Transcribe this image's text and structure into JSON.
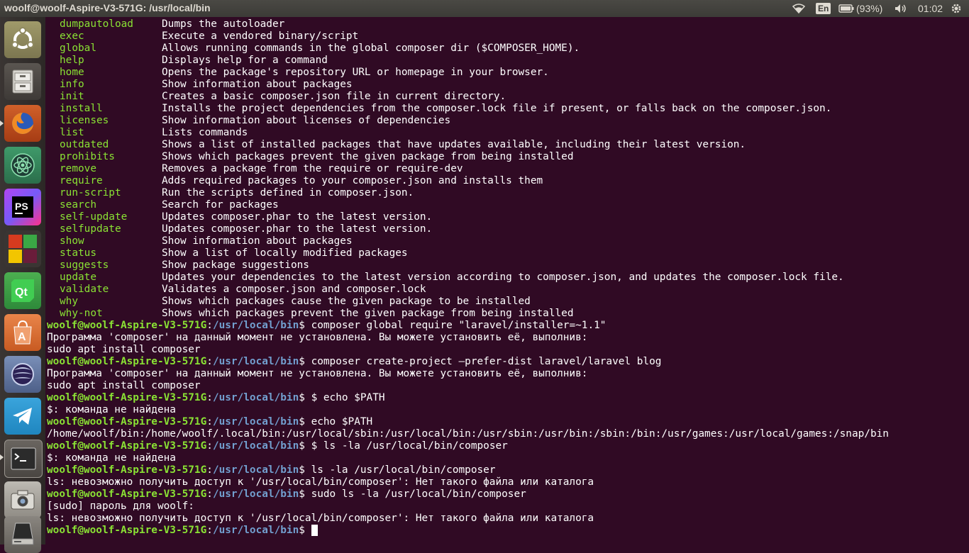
{
  "window": {
    "title": "woolf@woolf-Aspire-V3-571G: /usr/local/bin"
  },
  "panel": {
    "language": "En",
    "battery": "(93%)",
    "clock": "01:02"
  },
  "launcher": {
    "items": [
      "Ubuntu Dash",
      "Files",
      "Firefox",
      "Atom",
      "PhpStorm",
      "Workspace Switcher",
      "Qt Creator",
      "Ubuntu Software",
      "Eclipse",
      "Telegram",
      "Terminal",
      "Camera",
      "Removable Drive"
    ]
  },
  "terminal": {
    "commands": [
      {
        "cmd": "dumpautoload",
        "desc": "Dumps the autoloader"
      },
      {
        "cmd": "exec",
        "desc": "Execute a vendored binary/script"
      },
      {
        "cmd": "global",
        "desc": "Allows running commands in the global composer dir ($COMPOSER_HOME)."
      },
      {
        "cmd": "help",
        "desc": "Displays help for a command"
      },
      {
        "cmd": "home",
        "desc": "Opens the package's repository URL or homepage in your browser."
      },
      {
        "cmd": "info",
        "desc": "Show information about packages"
      },
      {
        "cmd": "init",
        "desc": "Creates a basic composer.json file in current directory."
      },
      {
        "cmd": "install",
        "desc": "Installs the project dependencies from the composer.lock file if present, or falls back on the composer.json."
      },
      {
        "cmd": "licenses",
        "desc": "Show information about licenses of dependencies"
      },
      {
        "cmd": "list",
        "desc": "Lists commands"
      },
      {
        "cmd": "outdated",
        "desc": "Shows a list of installed packages that have updates available, including their latest version."
      },
      {
        "cmd": "prohibits",
        "desc": "Shows which packages prevent the given package from being installed"
      },
      {
        "cmd": "remove",
        "desc": "Removes a package from the require or require-dev"
      },
      {
        "cmd": "require",
        "desc": "Adds required packages to your composer.json and installs them"
      },
      {
        "cmd": "run-script",
        "desc": "Run the scripts defined in composer.json."
      },
      {
        "cmd": "search",
        "desc": "Search for packages"
      },
      {
        "cmd": "self-update",
        "desc": "Updates composer.phar to the latest version."
      },
      {
        "cmd": "selfupdate",
        "desc": "Updates composer.phar to the latest version."
      },
      {
        "cmd": "show",
        "desc": "Show information about packages"
      },
      {
        "cmd": "status",
        "desc": "Show a list of locally modified packages"
      },
      {
        "cmd": "suggests",
        "desc": "Show package suggestions"
      },
      {
        "cmd": "update",
        "desc": "Updates your dependencies to the latest version according to composer.json, and updates the composer.lock file."
      },
      {
        "cmd": "validate",
        "desc": "Validates a composer.json and composer.lock"
      },
      {
        "cmd": "why",
        "desc": "Shows which packages cause the given package to be installed"
      },
      {
        "cmd": "why-not",
        "desc": "Shows which packages prevent the given package from being installed"
      }
    ],
    "prompt_user": "woolf@woolf-Aspire-V3-571G",
    "prompt_sep": ":",
    "prompt_path": "/usr/local/bin",
    "prompt_end": "$ ",
    "history": [
      {
        "type": "prompt",
        "text": "composer global require \"laravel/installer=~1.1\""
      },
      {
        "type": "out",
        "text": "Программа 'composer' на данный момент не установлена. Вы можете установить её, выполнив:"
      },
      {
        "type": "out",
        "text": "sudo apt install composer"
      },
      {
        "type": "prompt",
        "text": "composer create-project —prefer-dist laravel/laravel blog"
      },
      {
        "type": "out",
        "text": "Программа 'composer' на данный момент не установлена. Вы можете установить её, выполнив:"
      },
      {
        "type": "out",
        "text": "sudo apt install composer"
      },
      {
        "type": "prompt",
        "text": "$ echo $PATH"
      },
      {
        "type": "out",
        "text": "$: команда не найдена"
      },
      {
        "type": "prompt",
        "text": "echo $PATH"
      },
      {
        "type": "out",
        "text": "/home/woolf/bin:/home/woolf/.local/bin:/usr/local/sbin:/usr/local/bin:/usr/sbin:/usr/bin:/sbin:/bin:/usr/games:/usr/local/games:/snap/bin"
      },
      {
        "type": "prompt",
        "text": "$ ls -la /usr/local/bin/composer"
      },
      {
        "type": "out",
        "text": "$: команда не найдена"
      },
      {
        "type": "prompt",
        "text": "ls -la /usr/local/bin/composer"
      },
      {
        "type": "out",
        "text": "ls: невозможно получить доступ к '/usr/local/bin/composer': Нет такого файла или каталога"
      },
      {
        "type": "prompt",
        "text": "sudo ls -la /usr/local/bin/composer"
      },
      {
        "type": "out",
        "text": "[sudo] пароль для woolf:"
      },
      {
        "type": "out",
        "text": "ls: невозможно получить доступ к '/usr/local/bin/composer': Нет такого файла или каталога"
      },
      {
        "type": "prompt",
        "text": "",
        "cursor": true
      }
    ]
  },
  "colors": {
    "background": "#300a24",
    "command_green": "#8ae234",
    "path_blue": "#729fcf",
    "text": "#ffffff"
  }
}
